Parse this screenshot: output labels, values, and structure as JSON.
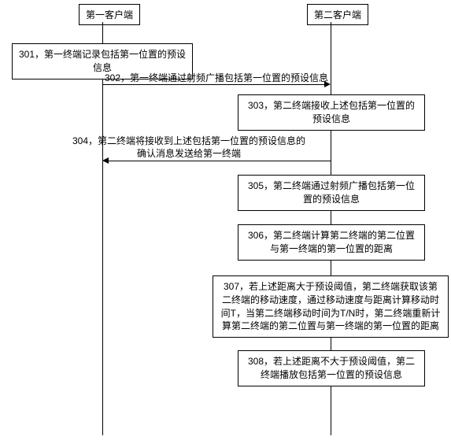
{
  "participants": {
    "p1": "第一客户端",
    "p2": "第二客户端"
  },
  "steps": {
    "s301": "301，第一终端记录包括第一位置的预设信息",
    "s302": "302，第一终端通过射频广播包括第一位置的预设信息",
    "s303_l1": "303，第二终端接收上述包括第一位置的",
    "s303_l2": "预设信息",
    "s304_l1": "304，第二终端将接收到上述包括第一位置的预设信息的",
    "s304_l2": "确认消息发送给第一终端",
    "s305_l1": "305，第二终端通过射频广播包括第一位",
    "s305_l2": "置的预设信息",
    "s306_l1": "306，第二终端计算第二终端的第二位置",
    "s306_l2": "与第一终端的第一位置的距离",
    "s307_l1": "307，若上述距离大于预设阈值，第二终端获取该第",
    "s307_l2": "二终端的移动速度，通过移动速度与距离计算移动时",
    "s307_l3": "间T，当第二终端移动时间为T/N时，第二终端重新计",
    "s307_l4": "算第二终端的第二位置与第一终端的第一位置的距离",
    "s308_l1": "308，若上述距离不大于预设阈值，第二",
    "s308_l2": "终端播放包括第一位置的预设信息"
  },
  "chart_data": {
    "type": "table",
    "title": "Sequence diagram",
    "participants": [
      "第一客户端",
      "第二客户端"
    ],
    "messages": [
      {
        "n": 301,
        "from": "第一客户端",
        "to": "第一客户端",
        "kind": "self-activity",
        "text": "第一终端记录包括第一位置的预设信息"
      },
      {
        "n": 302,
        "from": "第一客户端",
        "to": "第二客户端",
        "kind": "message",
        "text": "第一终端通过射频广播包括第一位置的预设信息"
      },
      {
        "n": 303,
        "from": "第二客户端",
        "to": "第二客户端",
        "kind": "self-activity",
        "text": "第二终端接收上述包括第一位置的预设信息"
      },
      {
        "n": 304,
        "from": "第二客户端",
        "to": "第一客户端",
        "kind": "message",
        "text": "第二终端将接收到上述包括第一位置的预设信息的确认消息发送给第一终端"
      },
      {
        "n": 305,
        "from": "第二客户端",
        "to": "第二客户端",
        "kind": "self-activity",
        "text": "第二终端通过射频广播包括第一位置的预设信息"
      },
      {
        "n": 306,
        "from": "第二客户端",
        "to": "第二客户端",
        "kind": "self-activity",
        "text": "第二终端计算第二终端的第二位置与第一终端的第一位置的距离"
      },
      {
        "n": 307,
        "from": "第二客户端",
        "to": "第二客户端",
        "kind": "self-activity",
        "text": "若上述距离大于预设阈值，第二终端获取该第二终端的移动速度，通过移动速度与距离计算移动时间T，当第二终端移动时间为T/N时，第二终端重新计算第二终端的第二位置与第一终端的第一位置的距离"
      },
      {
        "n": 308,
        "from": "第二客户端",
        "to": "第二客户端",
        "kind": "self-activity",
        "text": "若上述距离不大于预设阈值，第二终端播放包括第一位置的预设信息"
      }
    ]
  }
}
